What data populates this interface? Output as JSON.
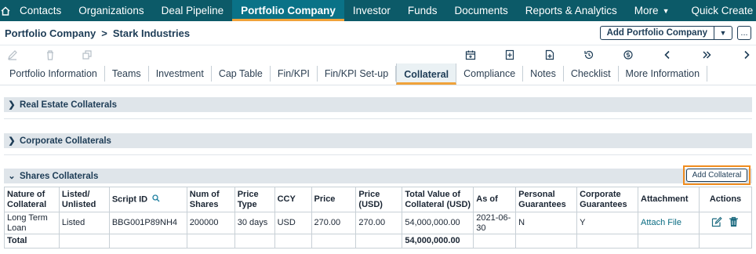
{
  "topnav": {
    "items": [
      "Contacts",
      "Organizations",
      "Deal Pipeline",
      "Portfolio Company",
      "Investor",
      "Funds",
      "Documents",
      "Reports & Analytics",
      "More",
      "Quick Create"
    ],
    "active": "Portfolio Company"
  },
  "breadcrumb": {
    "root": "Portfolio Company",
    "separator": ">",
    "current": "Stark Industries"
  },
  "header": {
    "add_button": "Add Portfolio Company",
    "more_label": "..."
  },
  "tabs": [
    "Portfolio Information",
    "Teams",
    "Investment",
    "Cap Table",
    "Fin/KPI",
    "Fin/KPI Set-up",
    "Collateral",
    "Compliance",
    "Notes",
    "Checklist",
    "More Information"
  ],
  "active_tab": "Collateral",
  "sections": {
    "real_estate": "Real Estate Collaterals",
    "corporate": "Corporate Collaterals",
    "shares": "Shares Collaterals"
  },
  "add_collateral": "Add Collateral",
  "table": {
    "headers": [
      "Nature of Collateral",
      "Listed/ Unlisted",
      "Script ID",
      "Num of Shares",
      "Price Type",
      "CCY",
      "Price",
      "Price (USD)",
      "Total Value of Collateral (USD)",
      "As of",
      "Personal Guarantees",
      "Corporate Guarantees",
      "Attachment",
      "Actions"
    ],
    "rows": [
      [
        "Long Term Loan",
        "Listed",
        "BBG001P89NH4",
        "200000",
        "30 days",
        "USD",
        "270.00",
        "270.00",
        "54,000,000.00",
        "2021-06-30",
        "N",
        "Y",
        "Attach File",
        ""
      ]
    ],
    "total_label": "Total",
    "total_value": "54,000,000.00"
  },
  "colors": {
    "nav_bg": "#0c5a68",
    "accent": "#f0a23a",
    "highlight": "#f08c1e",
    "text_dark": "#1d3c56"
  }
}
